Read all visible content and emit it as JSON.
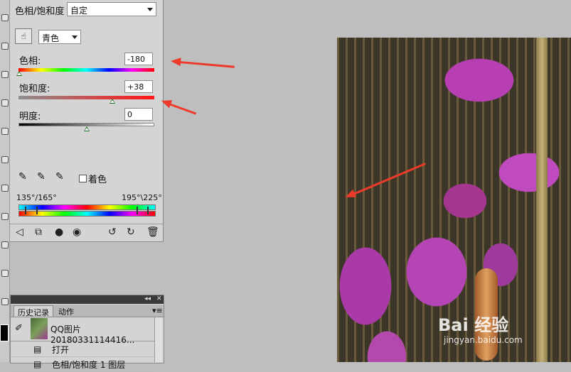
{
  "panel": {
    "title": "色相/饱和度",
    "preset": "自定",
    "channel": "青色",
    "hue_label": "色相:",
    "hue_value": "-180",
    "hue_level": -180,
    "saturation_label": "饱和度:",
    "saturation_value": "+38",
    "saturation_level": 38,
    "lightness_label": "明度:",
    "lightness_value": "0",
    "lightness_level": 0,
    "colorize_label": "着色",
    "range_left": "135°/165°",
    "range_right": "195°\\225°"
  },
  "history": {
    "tab_history": "历史记录",
    "tab_actions": "动作",
    "snapshot_name": "QQ图片20180331114416...",
    "steps": [
      "打开",
      "色相/饱和度 1 图层"
    ]
  },
  "image": {
    "watermark": "Bai 经验",
    "watermark_url": "jingyan.baidu.com"
  },
  "colors": {
    "arrow": "#ee3a2a",
    "panel_bg": "#d4d4d4",
    "workspace_bg": "#bebebe"
  }
}
